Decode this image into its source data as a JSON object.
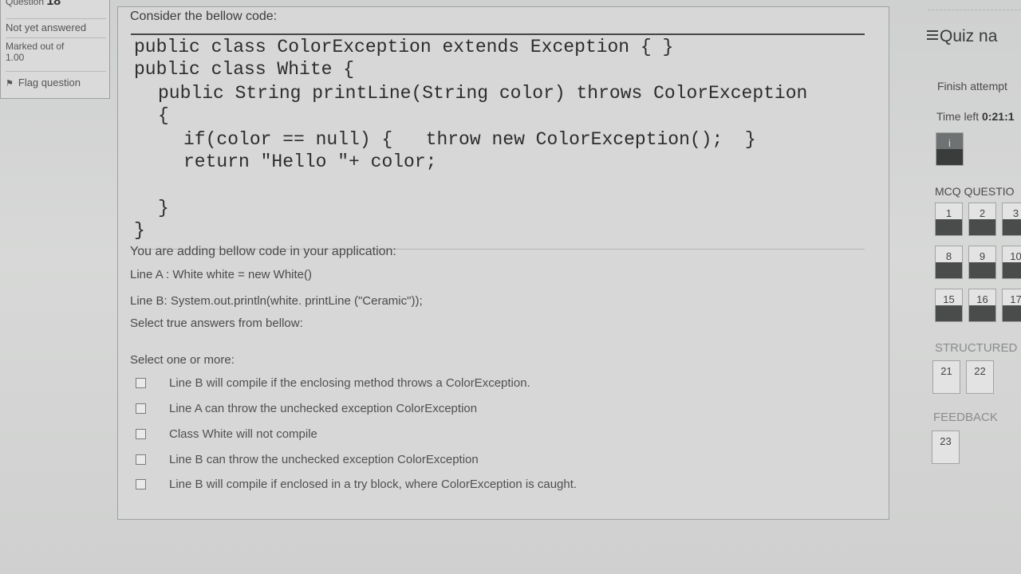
{
  "info": {
    "question_label": "Question",
    "question_number": "18",
    "status": "Not yet answered",
    "marked_out_of": "Marked out of",
    "marks": "1.00",
    "flag": "Flag question"
  },
  "question": {
    "prompt": "Consider the bellow code:",
    "code_lines": [
      "public class ColorException extends Exception { }",
      "public class White {",
      "public String printLine(String color) throws ColorException",
      "{",
      "if(color == null) {   throw new ColorException();  }",
      "return \"Hello \"+ color;",
      "}",
      "}"
    ],
    "intro": "You are adding bellow code in your application:",
    "line_a": "Line A : White white = new White()",
    "line_b": "Line B:  System.out.println(white. printLine (\"Ceramic\"));",
    "instruction": "Select true answers from bellow:",
    "select_label": "Select one or more:",
    "options": [
      "Line B will compile if the enclosing method throws a ColorException.",
      "Line A can throw the unchecked exception ColorException",
      "Class White will not compile",
      "Line B can throw the unchecked exception ColorException",
      "Line B will compile if enclosed in a try block, where ColorException is caught."
    ]
  },
  "nav": {
    "title": "Quiz na",
    "finish": "Finish attempt",
    "time_label": "Time left",
    "time_value": "0:21:1",
    "current_marker": "i",
    "section_mcq": "MCQ QUESTIO",
    "mcq_rows": [
      [
        "1",
        "2",
        "3"
      ],
      [
        "8",
        "9",
        "10"
      ],
      [
        "15",
        "16",
        "17"
      ]
    ],
    "section_structured": "STRUCTURED",
    "structured": [
      "21",
      "22"
    ],
    "section_feedback": "FEEDBACK",
    "feedback": [
      "23"
    ]
  }
}
